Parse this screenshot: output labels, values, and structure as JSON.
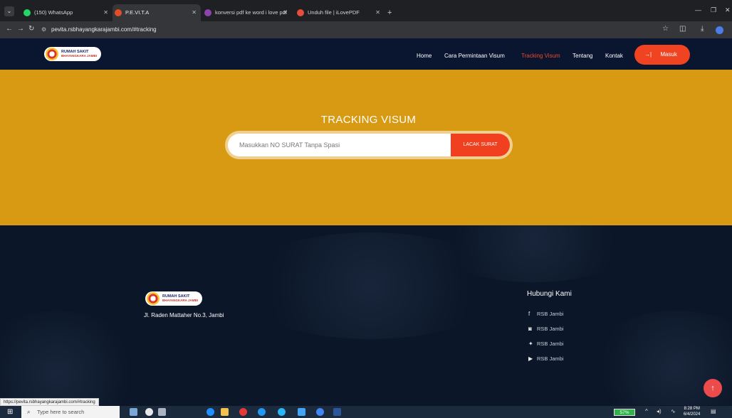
{
  "browser": {
    "tabs": [
      {
        "label": "(150) WhatsApp",
        "favicon_color": "#25d366"
      },
      {
        "label": "P.E.VI.T.A",
        "favicon_color": "#e44d26"
      },
      {
        "label": "konversi pdf ke word i love pdf",
        "favicon_color": "#8e44ad"
      },
      {
        "label": "Unduh file | iLovePDF",
        "favicon_color": "#e74c3c"
      }
    ],
    "new_tab": "+",
    "url": "pevita.rsbhayangkarajambi.com/#tracking",
    "status_url": "https://pevita.rsbhayangkarajambi.com/#tracking"
  },
  "site": {
    "logo": {
      "line1": "RUMAH SAKIT",
      "line2": "BHAYANGKARA JAMBI"
    },
    "nav": [
      {
        "label": "Home"
      },
      {
        "label": "Cara Permintaan Visum"
      },
      {
        "label": "Tracking Visum",
        "active": true
      },
      {
        "label": "Tentang"
      },
      {
        "label": "Kontak"
      }
    ],
    "login_label": "Masuk",
    "hero": {
      "title": "TRACKING VISUM",
      "placeholder": "Masukkan NO SURAT Tanpa Spasi",
      "button_label": "LACAK SURAT"
    },
    "footer": {
      "address": "Jl. Raden Mattaher No.3, Jambi",
      "contact_title": "Hubungi Kami",
      "contacts": [
        {
          "icon": "facebook-icon",
          "label": "RSB Jambi"
        },
        {
          "icon": "instagram-icon",
          "label": "RSB Jambi"
        },
        {
          "icon": "twitter-icon",
          "label": "RSB Jambi"
        },
        {
          "icon": "youtube-icon",
          "label": "RSB Jambi"
        }
      ]
    }
  },
  "taskbar": {
    "search_placeholder": "Type here to search",
    "battery": "57%",
    "time": "8:28 PM",
    "date": "6/4/2024"
  },
  "colors": {
    "accent": "#f04322",
    "hero_bg": "#d89a12",
    "header_bg": "#0a1530",
    "footer_bg": "#0b1628"
  }
}
